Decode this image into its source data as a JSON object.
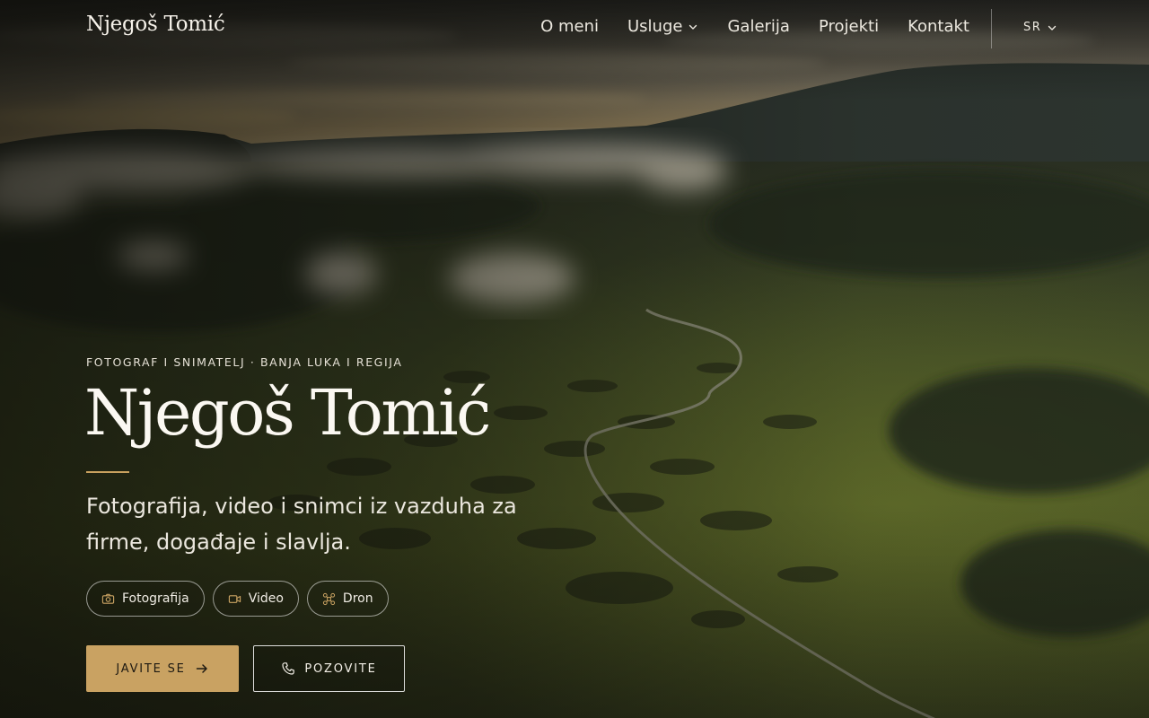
{
  "header": {
    "brand": "Njegoš Tomić",
    "nav": [
      {
        "label": "O meni",
        "has_dropdown": false
      },
      {
        "label": "Usluge",
        "has_dropdown": true
      },
      {
        "label": "Galerija",
        "has_dropdown": false
      },
      {
        "label": "Projekti",
        "has_dropdown": false
      },
      {
        "label": "Kontakt",
        "has_dropdown": false
      }
    ],
    "language": "SR"
  },
  "hero": {
    "eyebrow": "FOTOGRAF I SNIMATELJ · BANJA LUKA I REGIJA",
    "title": "Njegoš Tomić",
    "tagline": "Fotografija, video i snimci iz vazduha za firme, događaje i slavlja.",
    "chips": [
      {
        "label": "Fotografija",
        "icon": "camera-icon"
      },
      {
        "label": "Video",
        "icon": "video-camera-icon"
      },
      {
        "label": "Dron",
        "icon": "drone-icon"
      }
    ],
    "primary_button": {
      "label": "JAVITE SE",
      "icon": "arrow-right-icon"
    },
    "secondary_button": {
      "label": "POZOVITE",
      "icon": "phone-icon"
    }
  },
  "colors": {
    "accent": "#c9a262",
    "text": "#f2eee6",
    "background": "#1c1d16"
  }
}
